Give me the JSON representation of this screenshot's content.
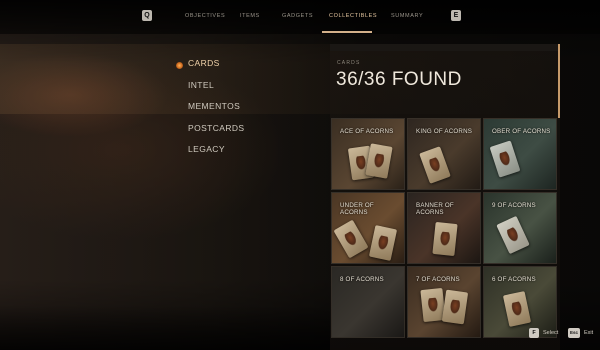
{
  "topbar": {
    "left_key": "Q",
    "right_key": "E",
    "tabs": [
      {
        "label": "OBJECTIVES",
        "active": false
      },
      {
        "label": "ITEMS",
        "active": false
      },
      {
        "label": "GADGETS",
        "active": false
      },
      {
        "label": "COLLECTIBLES",
        "active": true
      },
      {
        "label": "SUMMARY",
        "active": false
      }
    ]
  },
  "categories": [
    {
      "label": "CARDS",
      "active": true
    },
    {
      "label": "INTEL",
      "active": false
    },
    {
      "label": "MEMENTOS",
      "active": false
    },
    {
      "label": "POSTCARDS",
      "active": false
    },
    {
      "label": "LEGACY",
      "active": false
    }
  ],
  "panel": {
    "section_label": "CARDS",
    "found_text": "36/36 FOUND"
  },
  "cards": [
    {
      "name": "ACE OF ACORNS"
    },
    {
      "name": "KING OF ACORNS"
    },
    {
      "name": "OBER OF ACORNS"
    },
    {
      "name": "UNDER OF ACORNS"
    },
    {
      "name": "BANNER OF ACORNS"
    },
    {
      "name": "9 OF ACORNS"
    },
    {
      "name": "8 OF ACORNS"
    },
    {
      "name": "7 OF ACORNS"
    },
    {
      "name": "6 OF ACORNS"
    }
  ],
  "prompts": {
    "select_key": "F",
    "select_label": "Select",
    "exit_key": "Esc",
    "exit_label": "Exit"
  },
  "colors": {
    "accent": "#d3b08a",
    "active_text": "#f1d3aa",
    "selection_dot": "#ffb45a"
  }
}
